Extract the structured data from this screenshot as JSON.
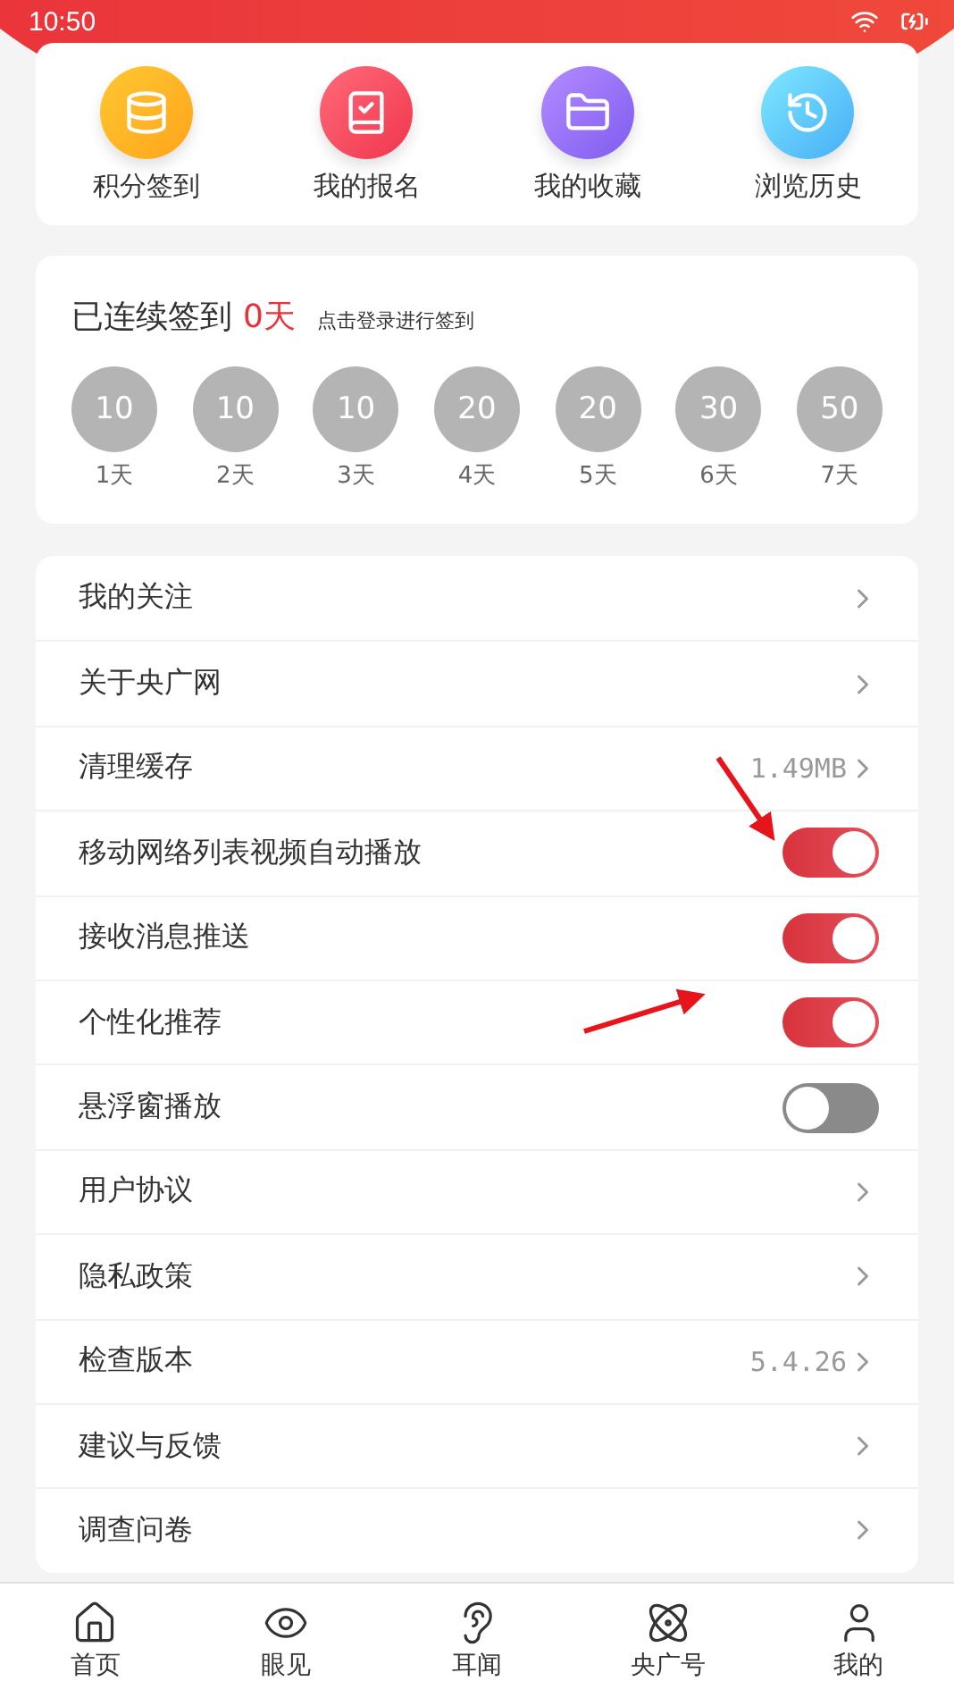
{
  "status_bar": {
    "time": "10:50"
  },
  "shortcuts": [
    {
      "label": "积分签到",
      "kind": "points"
    },
    {
      "label": "我的报名",
      "kind": "signup"
    },
    {
      "label": "我的收藏",
      "kind": "favorites"
    },
    {
      "label": "浏览历史",
      "kind": "history"
    }
  ],
  "checkin": {
    "title": "已连续签到",
    "days": "0天",
    "hint": "点击登录进行签到",
    "steps": [
      {
        "points": "10",
        "day": "1天"
      },
      {
        "points": "10",
        "day": "2天"
      },
      {
        "points": "10",
        "day": "3天"
      },
      {
        "points": "20",
        "day": "4天"
      },
      {
        "points": "20",
        "day": "5天"
      },
      {
        "points": "30",
        "day": "6天"
      },
      {
        "points": "50",
        "day": "7天"
      }
    ]
  },
  "settings": [
    {
      "kind": "link",
      "label": "我的关注"
    },
    {
      "kind": "link",
      "label": "关于央广网"
    },
    {
      "kind": "link",
      "label": "清理缓存",
      "value": "1.49MB"
    },
    {
      "kind": "toggle",
      "label": "移动网络列表视频自动播放",
      "on": true
    },
    {
      "kind": "toggle",
      "label": "接收消息推送",
      "on": true
    },
    {
      "kind": "toggle",
      "label": "个性化推荐",
      "on": true
    },
    {
      "kind": "toggle",
      "label": "悬浮窗播放",
      "on": false
    },
    {
      "kind": "link",
      "label": "用户协议"
    },
    {
      "kind": "link",
      "label": "隐私政策"
    },
    {
      "kind": "link",
      "label": "检查版本",
      "value": "5.4.26"
    },
    {
      "kind": "link",
      "label": "建议与反馈"
    },
    {
      "kind": "link",
      "label": "调查问卷"
    }
  ],
  "bottom_nav": [
    {
      "label": "首页",
      "kind": "home"
    },
    {
      "label": "眼见",
      "kind": "eye"
    },
    {
      "label": "耳闻",
      "kind": "ear"
    },
    {
      "label": "央广号",
      "kind": "orbit"
    },
    {
      "label": "我的",
      "kind": "user"
    }
  ]
}
